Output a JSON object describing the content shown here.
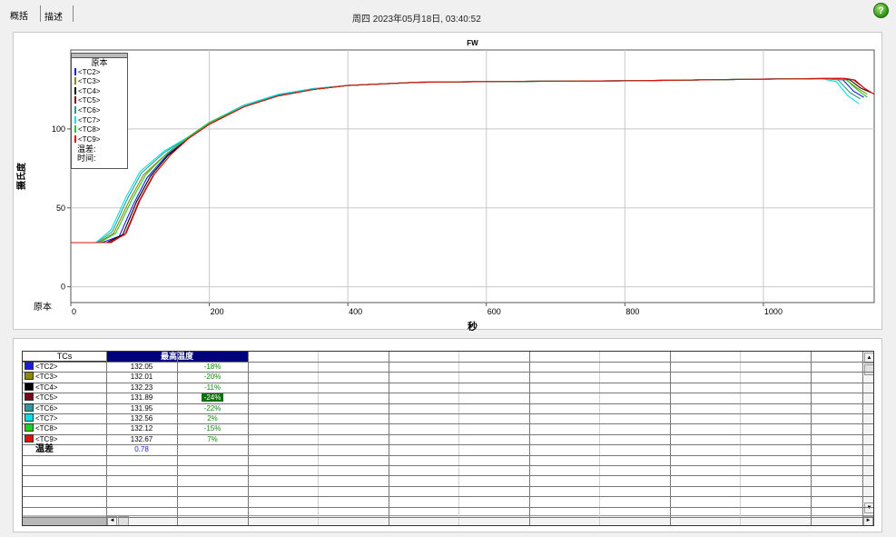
{
  "tabs": {
    "summary": "概括",
    "description": "描述"
  },
  "datetime": "周四 2023年05月18日, 03:40:52",
  "help_icon": "?",
  "chart_data": {
    "type": "line",
    "title": "FW",
    "xlabel": "秒",
    "ylabel": "摄氏度",
    "x_origin_label": "原本",
    "xlim": [
      0,
      1160
    ],
    "ylim": [
      -10,
      150
    ],
    "x_ticks": [
      0,
      200,
      400,
      600,
      800,
      1000
    ],
    "y_ticks": [
      0,
      50,
      100
    ],
    "grid": true,
    "legend_position": "top-left",
    "legend_title": "原本",
    "legend_extra": [
      "温差:",
      "时间:"
    ],
    "series": [
      {
        "name": "<TC2>",
        "color": "#1a1ae0",
        "points": [
          [
            0,
            28
          ],
          [
            45,
            28
          ],
          [
            70,
            32
          ],
          [
            90,
            52
          ],
          [
            110,
            69
          ],
          [
            140,
            84
          ],
          [
            170,
            94
          ],
          [
            200,
            103
          ],
          [
            250,
            114
          ],
          [
            300,
            121
          ],
          [
            350,
            125
          ],
          [
            400,
            127.5
          ],
          [
            500,
            129.5
          ],
          [
            600,
            130
          ],
          [
            800,
            130.5
          ],
          [
            1000,
            131.5
          ],
          [
            1090,
            132
          ],
          [
            1115,
            131
          ],
          [
            1130,
            124
          ],
          [
            1145,
            120
          ]
        ]
      },
      {
        "name": "<TC3>",
        "color": "#8a8a00",
        "points": [
          [
            0,
            28
          ],
          [
            40,
            28
          ],
          [
            62,
            34
          ],
          [
            85,
            55
          ],
          [
            105,
            71
          ],
          [
            140,
            85
          ],
          [
            170,
            95
          ],
          [
            200,
            104
          ],
          [
            250,
            115
          ],
          [
            300,
            121.5
          ],
          [
            350,
            125.5
          ],
          [
            400,
            127.5
          ],
          [
            500,
            129.5
          ],
          [
            600,
            130
          ],
          [
            800,
            130.5
          ],
          [
            1000,
            131.5
          ],
          [
            1095,
            132
          ],
          [
            1120,
            131
          ],
          [
            1135,
            126
          ],
          [
            1150,
            122
          ]
        ]
      },
      {
        "name": "<TC4>",
        "color": "#000000",
        "points": [
          [
            0,
            28
          ],
          [
            52,
            28
          ],
          [
            75,
            33
          ],
          [
            95,
            54
          ],
          [
            115,
            70
          ],
          [
            140,
            83
          ],
          [
            170,
            94
          ],
          [
            200,
            103
          ],
          [
            250,
            114
          ],
          [
            300,
            121
          ],
          [
            350,
            125
          ],
          [
            400,
            127.5
          ],
          [
            500,
            129.5
          ],
          [
            600,
            130
          ],
          [
            800,
            130.5
          ],
          [
            1000,
            131.5
          ],
          [
            1110,
            132
          ],
          [
            1125,
            131
          ],
          [
            1140,
            126
          ],
          [
            1155,
            123
          ]
        ]
      },
      {
        "name": "<TC5>",
        "color": "#7a0a1a",
        "points": [
          [
            0,
            28
          ],
          [
            58,
            28
          ],
          [
            80,
            34
          ],
          [
            100,
            55
          ],
          [
            120,
            71
          ],
          [
            145,
            84
          ],
          [
            170,
            94
          ],
          [
            200,
            103
          ],
          [
            250,
            114
          ],
          [
            300,
            121
          ],
          [
            350,
            125
          ],
          [
            400,
            127.5
          ],
          [
            500,
            129.5
          ],
          [
            600,
            130
          ],
          [
            800,
            130.5
          ],
          [
            1000,
            131.5
          ],
          [
            1118,
            132
          ],
          [
            1132,
            131
          ],
          [
            1148,
            125
          ],
          [
            1160,
            122
          ]
        ]
      },
      {
        "name": "<TC6>",
        "color": "#2a9a9a",
        "points": [
          [
            0,
            28
          ],
          [
            38,
            28
          ],
          [
            60,
            35
          ],
          [
            82,
            56
          ],
          [
            102,
            72
          ],
          [
            135,
            85
          ],
          [
            170,
            95
          ],
          [
            200,
            104
          ],
          [
            250,
            115
          ],
          [
            300,
            121.5
          ],
          [
            350,
            125.5
          ],
          [
            400,
            127.5
          ],
          [
            500,
            129.5
          ],
          [
            600,
            130
          ],
          [
            800,
            130.5
          ],
          [
            1000,
            131.5
          ],
          [
            1085,
            132
          ],
          [
            1108,
            131
          ],
          [
            1125,
            123
          ],
          [
            1140,
            119
          ]
        ]
      },
      {
        "name": "<TC7>",
        "color": "#00e0e0",
        "points": [
          [
            0,
            28
          ],
          [
            36,
            28
          ],
          [
            58,
            36
          ],
          [
            80,
            57
          ],
          [
            100,
            73
          ],
          [
            135,
            86
          ],
          [
            170,
            95
          ],
          [
            200,
            104
          ],
          [
            250,
            115
          ],
          [
            300,
            122
          ],
          [
            350,
            125.5
          ],
          [
            400,
            127.5
          ],
          [
            500,
            129.5
          ],
          [
            600,
            130
          ],
          [
            800,
            130.5
          ],
          [
            1000,
            131.5
          ],
          [
            1082,
            132
          ],
          [
            1105,
            130
          ],
          [
            1122,
            121
          ],
          [
            1138,
            116
          ]
        ]
      },
      {
        "name": "<TC8>",
        "color": "#22cc22",
        "points": [
          [
            0,
            28
          ],
          [
            42,
            28
          ],
          [
            65,
            34
          ],
          [
            88,
            55
          ],
          [
            108,
            71
          ],
          [
            140,
            85
          ],
          [
            170,
            95
          ],
          [
            200,
            104
          ],
          [
            250,
            114
          ],
          [
            300,
            121
          ],
          [
            350,
            125
          ],
          [
            400,
            127.5
          ],
          [
            500,
            129.5
          ],
          [
            600,
            130
          ],
          [
            800,
            130.5
          ],
          [
            1000,
            131.5
          ],
          [
            1100,
            132
          ],
          [
            1120,
            131
          ],
          [
            1135,
            125
          ],
          [
            1150,
            120
          ]
        ]
      },
      {
        "name": "<TC9>",
        "color": "#e01010",
        "points": [
          [
            0,
            28
          ],
          [
            55,
            28
          ],
          [
            78,
            33
          ],
          [
            98,
            54
          ],
          [
            118,
            70
          ],
          [
            145,
            84
          ],
          [
            170,
            94
          ],
          [
            200,
            103
          ],
          [
            250,
            114
          ],
          [
            300,
            121
          ],
          [
            350,
            125
          ],
          [
            400,
            127.5
          ],
          [
            500,
            129.5
          ],
          [
            600,
            130
          ],
          [
            800,
            130.5
          ],
          [
            1000,
            131.5
          ],
          [
            1115,
            132
          ],
          [
            1130,
            131
          ],
          [
            1145,
            126
          ],
          [
            1160,
            122
          ]
        ]
      }
    ]
  },
  "table": {
    "col_tcs": "TCs",
    "col_max": "最高温度",
    "rows": [
      {
        "name": "<TC2>",
        "color": "#1a1ae0",
        "value": "132.05",
        "pct": "-18%",
        "highlight": false
      },
      {
        "name": "<TC3>",
        "color": "#8a8a00",
        "value": "132.01",
        "pct": "-20%",
        "highlight": false
      },
      {
        "name": "<TC4>",
        "color": "#000000",
        "value": "132.23",
        "pct": "-11%",
        "highlight": false
      },
      {
        "name": "<TC5>",
        "color": "#7a0a1a",
        "value": "131.89",
        "pct": "-24%",
        "highlight": true
      },
      {
        "name": "<TC6>",
        "color": "#2a9a9a",
        "value": "131.95",
        "pct": "-22%",
        "highlight": false
      },
      {
        "name": "<TC7>",
        "color": "#00e0e0",
        "value": "132.56",
        "pct": "2%",
        "highlight": false
      },
      {
        "name": "<TC8>",
        "color": "#22cc22",
        "value": "132.12",
        "pct": "-15%",
        "highlight": false
      },
      {
        "name": "<TC9>",
        "color": "#e01010",
        "value": "132.67",
        "pct": "7%",
        "highlight": false
      }
    ],
    "diff_label": "温差",
    "diff_value": "0.78"
  },
  "scroll_icons": {
    "up": "▲",
    "down": "▼",
    "left": "◄",
    "right": "►"
  }
}
